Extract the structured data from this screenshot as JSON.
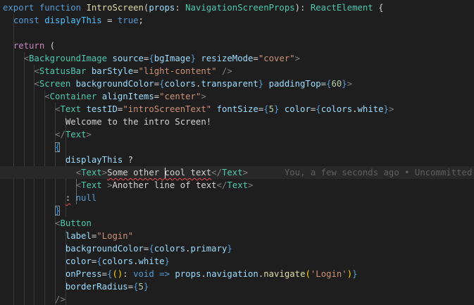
{
  "editor": {
    "lines": [
      [
        [
          "kw",
          "export"
        ],
        [
          "pl",
          " "
        ],
        [
          "kw",
          "function"
        ],
        [
          "pl",
          " "
        ],
        [
          "fn",
          "IntroScreen"
        ],
        [
          "pl",
          "("
        ],
        [
          "vr",
          "props"
        ],
        [
          "pl",
          ": "
        ],
        [
          "ty",
          "NavigationScreenProps"
        ],
        [
          "pl",
          "): "
        ],
        [
          "ty",
          "ReactElement"
        ],
        [
          "pl",
          " {"
        ]
      ],
      [
        [
          "pl",
          "  "
        ],
        [
          "kw",
          "const"
        ],
        [
          "pl",
          " "
        ],
        [
          "cst",
          "displayThis"
        ],
        [
          "pl",
          " = "
        ],
        [
          "kw",
          "true"
        ],
        [
          "pl",
          ";"
        ]
      ],
      [],
      [
        [
          "pl",
          "  "
        ],
        [
          "ctl",
          "return"
        ],
        [
          "pl",
          " ("
        ]
      ],
      [
        [
          "pl",
          "    "
        ],
        [
          "tb",
          "<"
        ],
        [
          "tag",
          "BackgroundImage"
        ],
        [
          "pl",
          " "
        ],
        [
          "at",
          "source"
        ],
        [
          "pl",
          "="
        ],
        [
          "kw",
          "{"
        ],
        [
          "vr",
          "bgImage"
        ],
        [
          "kw",
          "}"
        ],
        [
          "pl",
          " "
        ],
        [
          "at",
          "resizeMode"
        ],
        [
          "pl",
          "="
        ],
        [
          "str",
          "\"cover\""
        ],
        [
          "tb",
          ">"
        ]
      ],
      [
        [
          "pl",
          "      "
        ],
        [
          "tb",
          "<"
        ],
        [
          "tag",
          "StatusBar"
        ],
        [
          "pl",
          " "
        ],
        [
          "at",
          "barStyle"
        ],
        [
          "pl",
          "="
        ],
        [
          "str",
          "\"light-content\""
        ],
        [
          "pl",
          " "
        ],
        [
          "tb",
          "/>"
        ]
      ],
      [
        [
          "pl",
          "      "
        ],
        [
          "tb",
          "<"
        ],
        [
          "tag",
          "Screen"
        ],
        [
          "pl",
          " "
        ],
        [
          "at",
          "backgroundColor"
        ],
        [
          "pl",
          "="
        ],
        [
          "kw",
          "{"
        ],
        [
          "vr",
          "colors"
        ],
        [
          "pl",
          "."
        ],
        [
          "vr",
          "transparent"
        ],
        [
          "kw",
          "}"
        ],
        [
          "pl",
          " "
        ],
        [
          "at",
          "paddingTop"
        ],
        [
          "pl",
          "="
        ],
        [
          "kw",
          "{"
        ],
        [
          "num",
          "60"
        ],
        [
          "kw",
          "}"
        ],
        [
          "tb",
          ">"
        ]
      ],
      [
        [
          "pl",
          "        "
        ],
        [
          "tb",
          "<"
        ],
        [
          "tag",
          "Container"
        ],
        [
          "pl",
          " "
        ],
        [
          "at",
          "alignItems"
        ],
        [
          "pl",
          "="
        ],
        [
          "str",
          "\"center\""
        ],
        [
          "tb",
          ">"
        ]
      ],
      [
        [
          "pl",
          "          "
        ],
        [
          "tb",
          "<"
        ],
        [
          "tag",
          "Text"
        ],
        [
          "pl",
          " "
        ],
        [
          "at",
          "testID"
        ],
        [
          "pl",
          "="
        ],
        [
          "str",
          "\"introScreenText\""
        ],
        [
          "pl",
          " "
        ],
        [
          "at",
          "fontSize"
        ],
        [
          "pl",
          "="
        ],
        [
          "kw",
          "{"
        ],
        [
          "num",
          "5"
        ],
        [
          "kw",
          "}"
        ],
        [
          "pl",
          " "
        ],
        [
          "at",
          "color"
        ],
        [
          "pl",
          "="
        ],
        [
          "kw",
          "{"
        ],
        [
          "vr",
          "colors"
        ],
        [
          "pl",
          "."
        ],
        [
          "vr",
          "white"
        ],
        [
          "kw",
          "}"
        ],
        [
          "tb",
          ">"
        ]
      ],
      [
        [
          "pl",
          "            Welcome to the intro Screen!"
        ]
      ],
      [
        [
          "pl",
          "          "
        ],
        [
          "tb",
          "</"
        ],
        [
          "tag",
          "Text"
        ],
        [
          "tb",
          ">"
        ]
      ],
      [
        [
          "pl",
          "          "
        ],
        [
          "brc box",
          "{"
        ]
      ],
      [
        [
          "pl",
          "            "
        ],
        [
          "vr",
          "displayThis"
        ],
        [
          "pl",
          " ?"
        ]
      ],
      [
        [
          "pl",
          "              "
        ],
        [
          "tb",
          "<"
        ],
        [
          "tag",
          "Text"
        ],
        [
          "tb",
          ">"
        ],
        [
          "pl sq",
          "Some other cool text"
        ],
        [
          "tb",
          "</"
        ],
        [
          "tag",
          "Text"
        ],
        [
          "tb",
          ">"
        ],
        [
          "pl",
          "       "
        ],
        [
          "blame",
          "You, a few seconds ago • Uncommitted changes"
        ]
      ],
      [
        [
          "pl",
          "              "
        ],
        [
          "tb",
          "<"
        ],
        [
          "tag",
          "Text"
        ],
        [
          "pl",
          " "
        ],
        [
          "tb",
          ">"
        ],
        [
          "pl",
          "Another line of text"
        ],
        [
          "tb",
          "</"
        ],
        [
          "tag",
          "Text"
        ],
        [
          "tb",
          ">"
        ]
      ],
      [
        [
          "pl",
          "            "
        ],
        [
          "pl sq",
          ":"
        ],
        [
          "pl",
          " "
        ],
        [
          "kw",
          "null"
        ]
      ],
      [
        [
          "pl",
          "          "
        ],
        [
          "brc box",
          "}"
        ]
      ],
      [
        [
          "pl",
          "          "
        ],
        [
          "tb",
          "<"
        ],
        [
          "tag",
          "Button"
        ]
      ],
      [
        [
          "pl",
          "            "
        ],
        [
          "at",
          "label"
        ],
        [
          "pl",
          "="
        ],
        [
          "str",
          "\"Login\""
        ]
      ],
      [
        [
          "pl",
          "            "
        ],
        [
          "at",
          "backgroundColor"
        ],
        [
          "pl",
          "="
        ],
        [
          "kw",
          "{"
        ],
        [
          "vr",
          "colors"
        ],
        [
          "pl",
          "."
        ],
        [
          "vr",
          "primary"
        ],
        [
          "kw",
          "}"
        ]
      ],
      [
        [
          "pl",
          "            "
        ],
        [
          "at",
          "color"
        ],
        [
          "pl",
          "="
        ],
        [
          "kw",
          "{"
        ],
        [
          "vr",
          "colors"
        ],
        [
          "pl",
          "."
        ],
        [
          "vr",
          "white"
        ],
        [
          "kw",
          "}"
        ]
      ],
      [
        [
          "pl",
          "            "
        ],
        [
          "at",
          "onPress"
        ],
        [
          "pl",
          "="
        ],
        [
          "kw",
          "{"
        ],
        [
          "br",
          "("
        ],
        [
          "br",
          ")"
        ],
        [
          "pl",
          ": "
        ],
        [
          "kw",
          "void"
        ],
        [
          "pl",
          " "
        ],
        [
          "kw",
          "=>"
        ],
        [
          "pl",
          " "
        ],
        [
          "vr",
          "props"
        ],
        [
          "pl",
          "."
        ],
        [
          "vr",
          "navigation"
        ],
        [
          "pl",
          "."
        ],
        [
          "fn",
          "navigate"
        ],
        [
          "br",
          "("
        ],
        [
          "str",
          "'Login'"
        ],
        [
          "br",
          ")"
        ],
        [
          "kw",
          "}"
        ]
      ],
      [
        [
          "pl",
          "            "
        ],
        [
          "at",
          "borderRadius"
        ],
        [
          "pl",
          "="
        ],
        [
          "kw",
          "{"
        ],
        [
          "num",
          "5"
        ],
        [
          "kw",
          "}"
        ]
      ],
      [
        [
          "pl",
          "          "
        ],
        [
          "tb",
          "/>"
        ]
      ]
    ]
  }
}
